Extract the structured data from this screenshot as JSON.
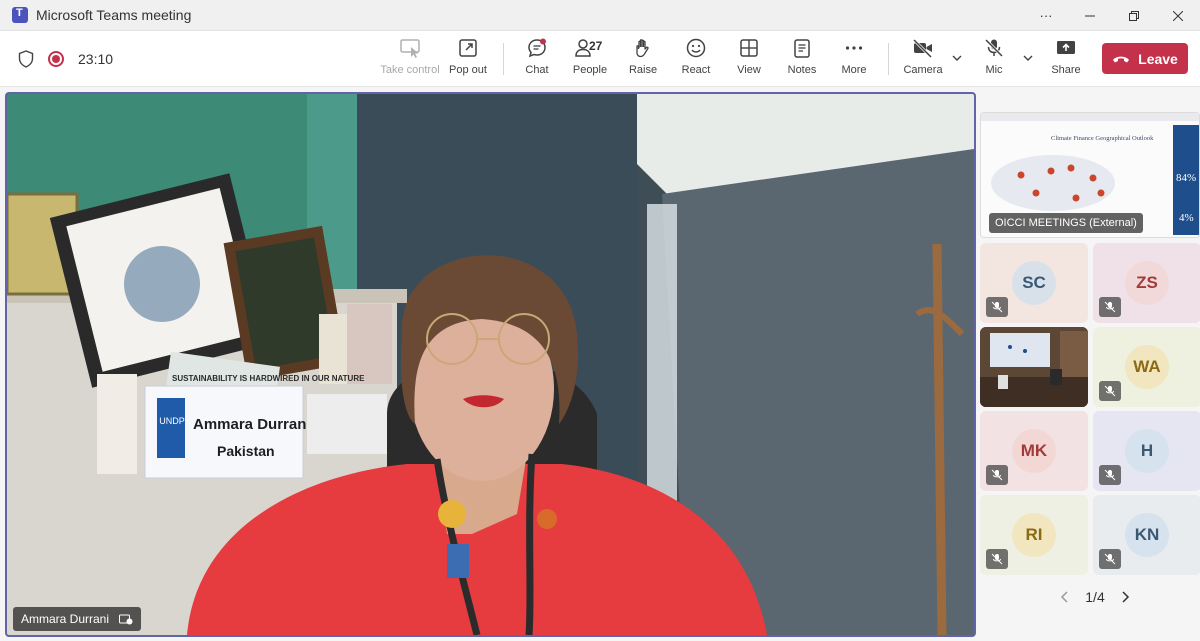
{
  "window": {
    "title": "Microsoft Teams meeting"
  },
  "toolbar": {
    "timer": "23:10",
    "buttons": {
      "take_control": "Take control",
      "pop_out": "Pop out",
      "chat": "Chat",
      "people": "People",
      "people_count": "27",
      "raise": "Raise",
      "react": "React",
      "view": "View",
      "notes": "Notes",
      "more": "More",
      "camera": "Camera",
      "mic": "Mic",
      "share": "Share"
    },
    "leave": "Leave"
  },
  "main_video": {
    "speaker_name": "Ammara Durrani",
    "nameplate_line1": "Ammara Durrani",
    "nameplate_line2": "Pakistan",
    "nameplate_logo": "UNDP",
    "poster_text": "SUSTAINABILITY IS HARDWIRED IN OUR NATURE"
  },
  "gallery": {
    "shared_screen": {
      "label": "OICCI MEETINGS (External)",
      "slide_title": "Climate Finance Geographical Outlook",
      "stat1": "84%",
      "stat2": "4%"
    },
    "participants": [
      {
        "initials": "SC",
        "color": "#3b5872",
        "bg": "#f3e6e1"
      },
      {
        "initials": "ZS",
        "color": "#a33a3a",
        "bg": "#f0e1e8"
      },
      {
        "initials": "",
        "video": true
      },
      {
        "initials": "WA",
        "color": "#8a6a12",
        "bg": "#eef0e0"
      },
      {
        "initials": "MK",
        "color": "#a33a3a",
        "bg": "#f3e2e4"
      },
      {
        "initials": "H",
        "color": "#3b5872",
        "bg": "#e6e6f2"
      },
      {
        "initials": "RI",
        "color": "#8a6a12",
        "bg": "#eef0e4"
      },
      {
        "initials": "KN",
        "color": "#3b5872",
        "bg": "#e8ecef"
      }
    ],
    "pager": "1/4"
  },
  "colors": {
    "accent": "#6264a7",
    "leave": "#c4314b"
  }
}
